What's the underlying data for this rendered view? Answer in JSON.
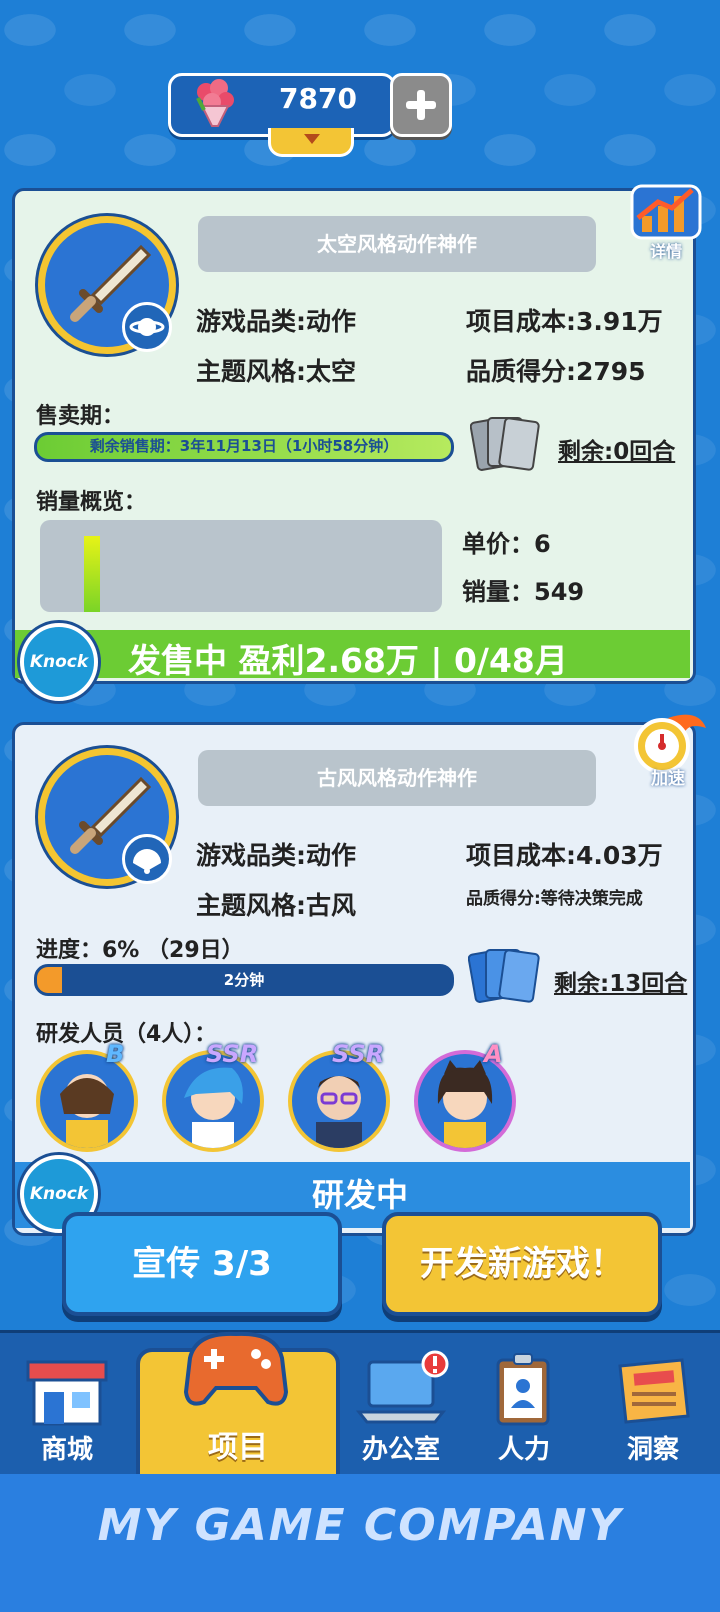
{
  "currency": {
    "value": "7870",
    "icon": "flower-bouquet-icon"
  },
  "card1": {
    "title": "太空风格动作神作",
    "detail_label": "详情",
    "category": "游戏品类:动作",
    "theme": "主题风格:太空",
    "cost": "项目成本:3.91万",
    "quality": "品质得分:2795",
    "sale_period_label": "售卖期：",
    "sale_period_text": "剩余销售期：3年11月13日（1小时58分钟）",
    "sale_period_fraction": 1.0,
    "remaining": "剩余:0回合",
    "sales_overview_label": "销量概览：",
    "unit_price": "单价：6",
    "sales": "销量：549",
    "status": "发售中 盈利2.68万 | 0/48月",
    "knock": "Knock"
  },
  "card2": {
    "title": "古风风格动作神作",
    "speed_label": "加速",
    "category": "游戏品类:动作",
    "theme": "主题风格:古风",
    "cost": "项目成本:4.03万",
    "quality": "品质得分:等待决策完成",
    "progress_label": "进度：6% （29日）",
    "progress_fraction": 0.06,
    "progress_text": "2分钟",
    "remaining": "剩余:13回合",
    "staff_label": "研发人员（4人）：",
    "staff": [
      {
        "rank": "B",
        "rank_color": "#5fb8ff"
      },
      {
        "rank": "SSR",
        "rank_color": "#c9a7ff"
      },
      {
        "rank": "SSR",
        "rank_color": "#c9a7ff"
      },
      {
        "rank": "A",
        "rank_color": "#ff8fc4"
      }
    ],
    "status": "研发中",
    "knock": "Knock"
  },
  "buttons": {
    "promote": "宣传 3/3",
    "new_game": "开发新游戏！"
  },
  "nav": [
    {
      "label": "商城",
      "icon": "shop-icon"
    },
    {
      "label": "项目",
      "icon": "gamepad-icon"
    },
    {
      "label": "办公室",
      "icon": "laptop-icon"
    },
    {
      "label": "人力",
      "icon": "clipboard-icon"
    },
    {
      "label": "洞察",
      "icon": "news-icon"
    }
  ],
  "footer": {
    "brand": "MY GAME COMPANY"
  },
  "colors": {
    "accent_green": "#6ccc34",
    "accent_yellow": "#f3c535",
    "accent_blue": "#1e7fd6"
  }
}
